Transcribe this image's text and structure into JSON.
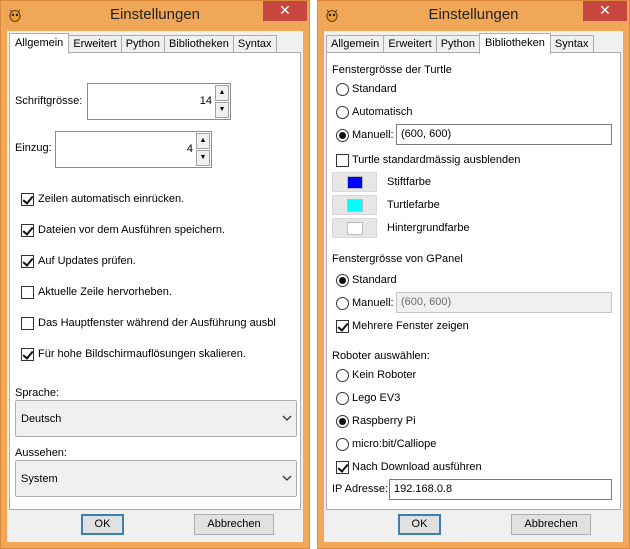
{
  "left_window": {
    "title": "Einstellungen",
    "close_label": "✕",
    "tabs": [
      "Allgemein",
      "Erweitert",
      "Python",
      "Bibliotheken",
      "Syntax"
    ],
    "active_tab": "Allgemein",
    "font_size_label": "Schriftgrösse:",
    "font_size_value": "14",
    "indent_label": "Einzug:",
    "indent_value": "4",
    "checkboxes": [
      {
        "label": "Zeilen automatisch einrücken.",
        "checked": true
      },
      {
        "label": "Dateien vor dem Ausführen speichern.",
        "checked": true
      },
      {
        "label": "Auf Updates prüfen.",
        "checked": true
      },
      {
        "label": "Aktuelle Zeile hervorheben.",
        "checked": false
      },
      {
        "label": "Das Hauptfenster während der Ausführung ausble",
        "checked": false
      },
      {
        "label": "Für hohe Bildschirmauflösungen skalieren.",
        "checked": true
      }
    ],
    "language_label": "Sprache:",
    "language_value": "Deutsch",
    "appearance_label": "Aussehen:",
    "appearance_value": "System",
    "ok_label": "OK",
    "cancel_label": "Abbrechen"
  },
  "right_window": {
    "title": "Einstellungen",
    "close_label": "✕",
    "tabs": [
      "Allgemein",
      "Erweitert",
      "Python",
      "Bibliotheken",
      "Syntax"
    ],
    "active_tab": "Bibliotheken",
    "turtle_section": "Fenstergrösse der Turtle",
    "turtle_options": [
      "Standard",
      "Automatisch",
      "Manuell:"
    ],
    "turtle_selected": "Manuell:",
    "turtle_size_value": "(600, 600)",
    "hide_turtle_label": "Turtle standardmässig ausblenden",
    "hide_turtle_checked": false,
    "colors": [
      {
        "label": "Stiftfarbe",
        "color": "#0000ff"
      },
      {
        "label": "Turtlefarbe",
        "color": "#00ffff"
      },
      {
        "label": "Hintergrundfarbe",
        "color": "#ffffff"
      }
    ],
    "gpanel_section": "Fenstergrösse von GPanel",
    "gpanel_options": [
      "Standard",
      "Manuell:"
    ],
    "gpanel_selected": "Standard",
    "gpanel_size_value": "(600, 600)",
    "multi_window_label": "Mehrere Fenster zeigen",
    "multi_window_checked": true,
    "robot_section": "Roboter auswählen:",
    "robot_options": [
      "Kein Roboter",
      "Lego EV3",
      "Raspberry Pi",
      "micro:bit/Calliope"
    ],
    "robot_selected": "Raspberry Pi",
    "run_after_download_label": "Nach Download ausführen",
    "run_after_download_checked": true,
    "ip_label": "IP Adresse:",
    "ip_value": "192.168.0.8",
    "ok_label": "OK",
    "cancel_label": "Abbrechen"
  },
  "theme": {
    "frame_color": "#f0a858",
    "close_color": "#c7463e",
    "default_button_border": "#3c7fb1"
  }
}
